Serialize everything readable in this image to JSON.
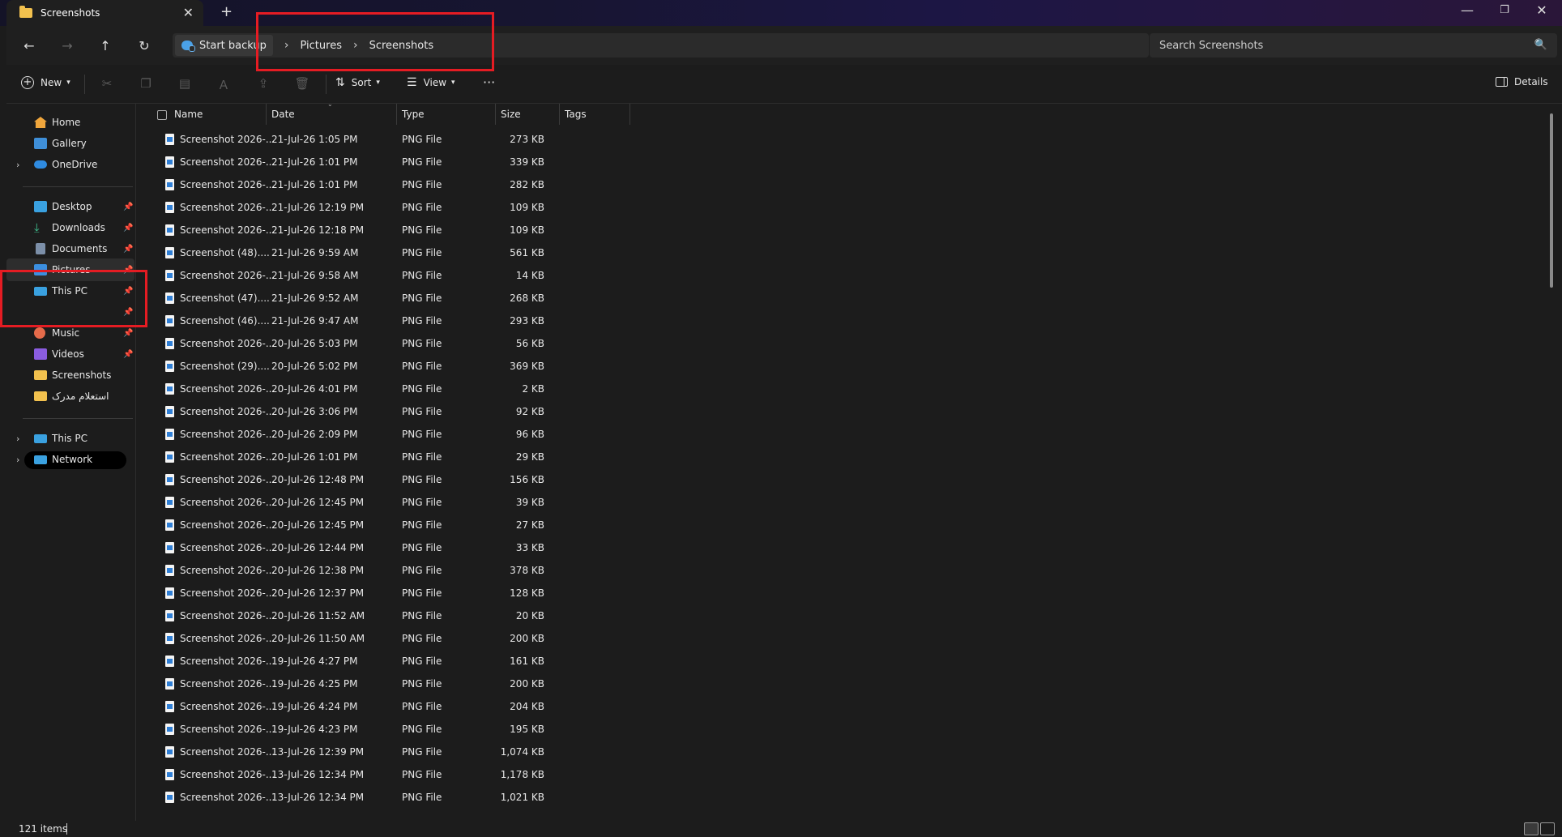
{
  "window": {
    "tab_title": "Screenshots",
    "close_tab": "✕",
    "new_tab": "+",
    "minimize": "—",
    "maximize": "❐",
    "close": "✕"
  },
  "nav": {
    "back": "←",
    "forward": "→",
    "up": "↑",
    "refresh": "↻"
  },
  "address": {
    "backup": "Start backup",
    "crumbs": [
      "Pictures",
      "Screenshots"
    ],
    "sep": "›"
  },
  "search": {
    "placeholder": "Search Screenshots",
    "icon": "🔍"
  },
  "toolbar": {
    "new_label": "New",
    "sort_label": "Sort",
    "view_label": "View",
    "more_label": "···",
    "details_label": "Details"
  },
  "sidebar": {
    "items": [
      {
        "label": "Home",
        "icon": "home-icon",
        "color": "#f0a63c"
      },
      {
        "label": "Gallery",
        "icon": "gallery-icon",
        "color": "#3f8fd8"
      },
      {
        "label": "OneDrive",
        "icon": "cloud-icon",
        "color": "#2f8be0"
      },
      {
        "label": "Desktop",
        "icon": "desktop-icon",
        "color": "#3aa1e0"
      },
      {
        "label": "Downloads",
        "icon": "download-icon",
        "color": "#3fbf8f"
      },
      {
        "label": "Documents",
        "icon": "document-icon",
        "color": "#7c8fa8"
      },
      {
        "label": "Pictures",
        "icon": "pictures-icon",
        "color": "#3b8fe0"
      },
      {
        "label": "This PC",
        "icon": "pc-icon",
        "color": "#3aa1e0"
      },
      {
        "label": "Music",
        "icon": "music-icon",
        "color": "#e56b4a"
      },
      {
        "label": "Videos",
        "icon": "videos-icon",
        "color": "#8a5ce0"
      },
      {
        "label": "Screenshots",
        "icon": "folder-icon",
        "color": "#f2c14e"
      },
      {
        "label": "استعلام مدرک",
        "icon": "folder-icon",
        "color": "#f2c14e"
      },
      {
        "label": "This PC",
        "icon": "pc-icon",
        "color": "#3aa1e0"
      },
      {
        "label": "Network",
        "icon": "network-icon",
        "color": "#3aa1e0"
      }
    ],
    "pin": "📌",
    "chevron": "›"
  },
  "columns": [
    "Name",
    "Date",
    "Type",
    "Size",
    "Tags"
  ],
  "files": [
    {
      "name": "Screenshot 2026-...",
      "date": "21-Jul-26 1:05 PM",
      "type": "PNG File",
      "size": "273 KB"
    },
    {
      "name": "Screenshot 2026-...",
      "date": "21-Jul-26 1:01 PM",
      "type": "PNG File",
      "size": "339 KB"
    },
    {
      "name": "Screenshot 2026-...",
      "date": "21-Jul-26 1:01 PM",
      "type": "PNG File",
      "size": "282 KB"
    },
    {
      "name": "Screenshot 2026-...",
      "date": "21-Jul-26 12:19 PM",
      "type": "PNG File",
      "size": "109 KB"
    },
    {
      "name": "Screenshot 2026-...",
      "date": "21-Jul-26 12:18 PM",
      "type": "PNG File",
      "size": "109 KB"
    },
    {
      "name": "Screenshot (48)....",
      "date": "21-Jul-26 9:59 AM",
      "type": "PNG File",
      "size": "561 KB"
    },
    {
      "name": "Screenshot 2026-...",
      "date": "21-Jul-26 9:58 AM",
      "type": "PNG File",
      "size": "14 KB"
    },
    {
      "name": "Screenshot (47)....",
      "date": "21-Jul-26 9:52 AM",
      "type": "PNG File",
      "size": "268 KB"
    },
    {
      "name": "Screenshot (46)....",
      "date": "21-Jul-26 9:47 AM",
      "type": "PNG File",
      "size": "293 KB"
    },
    {
      "name": "Screenshot 2026-...",
      "date": "20-Jul-26 5:03 PM",
      "type": "PNG File",
      "size": "56 KB"
    },
    {
      "name": "Screenshot (29)....",
      "date": "20-Jul-26 5:02 PM",
      "type": "PNG File",
      "size": "369 KB"
    },
    {
      "name": "Screenshot 2026-...",
      "date": "20-Jul-26 4:01 PM",
      "type": "PNG File",
      "size": "2 KB"
    },
    {
      "name": "Screenshot 2026-...",
      "date": "20-Jul-26 3:06 PM",
      "type": "PNG File",
      "size": "92 KB"
    },
    {
      "name": "Screenshot 2026-...",
      "date": "20-Jul-26 2:09 PM",
      "type": "PNG File",
      "size": "96 KB"
    },
    {
      "name": "Screenshot 2026-...",
      "date": "20-Jul-26 1:01 PM",
      "type": "PNG File",
      "size": "29 KB"
    },
    {
      "name": "Screenshot 2026-...",
      "date": "20-Jul-26 12:48 PM",
      "type": "PNG File",
      "size": "156 KB"
    },
    {
      "name": "Screenshot 2026-...",
      "date": "20-Jul-26 12:45 PM",
      "type": "PNG File",
      "size": "39 KB"
    },
    {
      "name": "Screenshot 2026-...",
      "date": "20-Jul-26 12:45 PM",
      "type": "PNG File",
      "size": "27 KB"
    },
    {
      "name": "Screenshot 2026-...",
      "date": "20-Jul-26 12:44 PM",
      "type": "PNG File",
      "size": "33 KB"
    },
    {
      "name": "Screenshot 2026-...",
      "date": "20-Jul-26 12:38 PM",
      "type": "PNG File",
      "size": "378 KB"
    },
    {
      "name": "Screenshot 2026-...",
      "date": "20-Jul-26 12:37 PM",
      "type": "PNG File",
      "size": "128 KB"
    },
    {
      "name": "Screenshot 2026-...",
      "date": "20-Jul-26 11:52 AM",
      "type": "PNG File",
      "size": "20 KB"
    },
    {
      "name": "Screenshot 2026-...",
      "date": "20-Jul-26 11:50 AM",
      "type": "PNG File",
      "size": "200 KB"
    },
    {
      "name": "Screenshot 2026-...",
      "date": "19-Jul-26 4:27 PM",
      "type": "PNG File",
      "size": "161 KB"
    },
    {
      "name": "Screenshot 2026-...",
      "date": "19-Jul-26 4:25 PM",
      "type": "PNG File",
      "size": "200 KB"
    },
    {
      "name": "Screenshot 2026-...",
      "date": "19-Jul-26 4:24 PM",
      "type": "PNG File",
      "size": "204 KB"
    },
    {
      "name": "Screenshot 2026-...",
      "date": "19-Jul-26 4:23 PM",
      "type": "PNG File",
      "size": "195 KB"
    },
    {
      "name": "Screenshot 2026-...",
      "date": "13-Jul-26 12:39 PM",
      "type": "PNG File",
      "size": "1,074 KB"
    },
    {
      "name": "Screenshot 2026-...",
      "date": "13-Jul-26 12:34 PM",
      "type": "PNG File",
      "size": "1,178 KB"
    },
    {
      "name": "Screenshot 2026-...",
      "date": "13-Jul-26 12:34 PM",
      "type": "PNG File",
      "size": "1,021 KB"
    }
  ],
  "status": {
    "count": "121 items"
  }
}
